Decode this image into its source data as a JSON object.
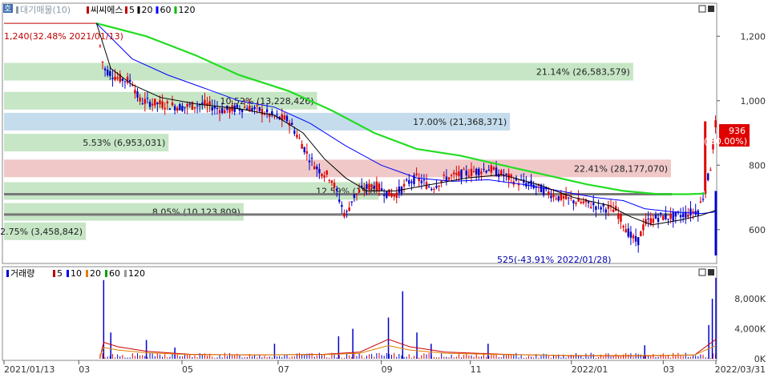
{
  "price_panel": {
    "legend": {
      "badge": "호",
      "items": [
        {
          "label": "대기매물(10)",
          "color": "#8a9aa8"
        },
        {
          "label": "씨씨에스",
          "color": "#c00000"
        },
        {
          "label": "5",
          "color": "#c00000"
        },
        {
          "label": "20",
          "color": "#000000"
        },
        {
          "label": "60",
          "color": "#0000ff"
        },
        {
          "label": "120",
          "color": "#00bb00"
        }
      ]
    },
    "high_annotation": "1,240(32.48% 2021/01/13)",
    "low_annotation": "525(-43.91% 2022/01/28)",
    "current_price": "936",
    "current_change": "( 30.00%)",
    "price_axis": [
      "1,200",
      "1,000",
      "800",
      "600"
    ],
    "horizontal_lines": [
      710,
      647
    ]
  },
  "volume_panel": {
    "legend": {
      "title": "거래량",
      "items": [
        {
          "label": "5",
          "color": "#c00000"
        },
        {
          "label": "10",
          "color": "#0000ff"
        },
        {
          "label": "20",
          "color": "#e08000"
        },
        {
          "label": "60",
          "color": "#00a000"
        },
        {
          "label": "120",
          "color": "#999999"
        }
      ]
    },
    "volume_axis": [
      "8,000K",
      "4,000K",
      "0K"
    ]
  },
  "x_axis_labels": [
    "2021/01/13",
    "03",
    "05",
    "07",
    "09",
    "11",
    "2022/01",
    "03",
    "2022/03/31"
  ],
  "colors": {
    "up": "#e00000",
    "down": "#0000cc",
    "ma5": "#cc0000",
    "ma20": "#000000",
    "ma60": "#0000ff",
    "ma120": "#22dd22",
    "green_band": "#c6e6c6",
    "blue_band": "#c4dcec",
    "red_band": "#f0c8c8",
    "label_box": "#e00000"
  },
  "chart_data": {
    "type": "candlestick",
    "x_range": [
      "2021/01/13",
      "2022/03/31"
    ],
    "price_range": [
      500,
      1300
    ],
    "volume_range": [
      0,
      11000
    ],
    "volume_profile": [
      {
        "price": 1090,
        "label": "21.14% (26,583,579)",
        "share": 21.14,
        "volume": 26583579,
        "color": "green"
      },
      {
        "price": 1000,
        "label": "10.52% (13,228,426)",
        "share": 10.52,
        "volume": 13228426,
        "color": "green"
      },
      {
        "price": 935,
        "label": "17.00% (21,368,371)",
        "share": 17.0,
        "volume": 21368371,
        "color": "blue"
      },
      {
        "price": 870,
        "label": "5.53% (6,953,031)",
        "share": 5.53,
        "volume": 6953031,
        "color": "green"
      },
      {
        "price": 790,
        "label": "22.41% (28,177,070)",
        "share": 22.41,
        "volume": 28177070,
        "color": "red"
      },
      {
        "price": 720,
        "label": "12.59% (15,8",
        "share": 12.59,
        "volume": null,
        "color": "green"
      },
      {
        "price": 655,
        "label": "8.05% (10,123,809)",
        "share": 8.05,
        "volume": 10123809,
        "color": "green"
      },
      {
        "price": 595,
        "label": "2.75% (3,458,842)",
        "share": 2.75,
        "volume": 3458842,
        "color": "green"
      }
    ],
    "candle_path": [
      [
        0,
        1240
      ],
      [
        0.13,
        1240
      ],
      [
        0.14,
        1100
      ],
      [
        0.16,
        1070
      ],
      [
        0.18,
        1060
      ],
      [
        0.19,
        1000
      ],
      [
        0.22,
        990
      ],
      [
        0.25,
        980
      ],
      [
        0.28,
        990
      ],
      [
        0.31,
        970
      ],
      [
        0.34,
        980
      ],
      [
        0.36,
        970
      ],
      [
        0.38,
        950
      ],
      [
        0.4,
        940
      ],
      [
        0.41,
        900
      ],
      [
        0.43,
        820
      ],
      [
        0.44,
        790
      ],
      [
        0.46,
        760
      ],
      [
        0.47,
        700
      ],
      [
        0.48,
        640
      ],
      [
        0.49,
        700
      ],
      [
        0.5,
        720
      ],
      [
        0.52,
        740
      ],
      [
        0.54,
        710
      ],
      [
        0.55,
        710
      ],
      [
        0.57,
        750
      ],
      [
        0.58,
        760
      ],
      [
        0.6,
        730
      ],
      [
        0.62,
        760
      ],
      [
        0.64,
        770
      ],
      [
        0.66,
        780
      ],
      [
        0.68,
        790
      ],
      [
        0.7,
        770
      ],
      [
        0.72,
        750
      ],
      [
        0.74,
        740
      ],
      [
        0.76,
        720
      ],
      [
        0.78,
        700
      ],
      [
        0.8,
        690
      ],
      [
        0.82,
        680
      ],
      [
        0.84,
        670
      ],
      [
        0.86,
        660
      ],
      [
        0.88,
        580
      ],
      [
        0.89,
        560
      ],
      [
        0.9,
        620
      ],
      [
        0.92,
        640
      ],
      [
        0.94,
        640
      ],
      [
        0.96,
        650
      ],
      [
        0.975,
        660
      ],
      [
        0.985,
        720
      ],
      [
        0.993,
        800
      ],
      [
        1.0,
        936
      ]
    ],
    "ma20_path": [
      [
        0.13,
        1240
      ],
      [
        0.15,
        1100
      ],
      [
        0.18,
        1050
      ],
      [
        0.22,
        1010
      ],
      [
        0.27,
        990
      ],
      [
        0.33,
        975
      ],
      [
        0.38,
        955
      ],
      [
        0.42,
        900
      ],
      [
        0.45,
        820
      ],
      [
        0.48,
        760
      ],
      [
        0.51,
        720
      ],
      [
        0.55,
        720
      ],
      [
        0.6,
        740
      ],
      [
        0.65,
        760
      ],
      [
        0.7,
        770
      ],
      [
        0.75,
        740
      ],
      [
        0.8,
        700
      ],
      [
        0.85,
        675
      ],
      [
        0.88,
        640
      ],
      [
        0.91,
        615
      ],
      [
        0.95,
        630
      ],
      [
        0.98,
        645
      ],
      [
        1.0,
        660
      ]
    ],
    "ma60_path": [
      [
        0.13,
        1240
      ],
      [
        0.18,
        1130
      ],
      [
        0.23,
        1080
      ],
      [
        0.28,
        1040
      ],
      [
        0.33,
        1000
      ],
      [
        0.38,
        980
      ],
      [
        0.43,
        930
      ],
      [
        0.48,
        860
      ],
      [
        0.53,
        800
      ],
      [
        0.58,
        760
      ],
      [
        0.63,
        750
      ],
      [
        0.68,
        755
      ],
      [
        0.73,
        740
      ],
      [
        0.78,
        720
      ],
      [
        0.83,
        700
      ],
      [
        0.87,
        690
      ],
      [
        0.9,
        665
      ],
      [
        0.94,
        655
      ],
      [
        0.98,
        650
      ],
      [
        1.0,
        655
      ]
    ],
    "ma120_path": [
      [
        0.13,
        1240
      ],
      [
        0.2,
        1200
      ],
      [
        0.27,
        1140
      ],
      [
        0.33,
        1080
      ],
      [
        0.4,
        1030
      ],
      [
        0.46,
        970
      ],
      [
        0.52,
        900
      ],
      [
        0.58,
        850
      ],
      [
        0.64,
        830
      ],
      [
        0.7,
        800
      ],
      [
        0.76,
        770
      ],
      [
        0.82,
        740
      ],
      [
        0.87,
        720
      ],
      [
        0.92,
        710
      ],
      [
        0.96,
        710
      ],
      [
        0.985,
        712
      ]
    ],
    "volume_spikes": [
      [
        0.14,
        10500
      ],
      [
        0.15,
        3500
      ],
      [
        0.2,
        2500
      ],
      [
        0.24,
        1500
      ],
      [
        0.38,
        2000
      ],
      [
        0.47,
        3000
      ],
      [
        0.49,
        4000
      ],
      [
        0.54,
        5500
      ],
      [
        0.56,
        9000
      ],
      [
        0.58,
        3500
      ],
      [
        0.6,
        2000
      ],
      [
        0.68,
        2000
      ],
      [
        0.9,
        1800
      ],
      [
        0.99,
        4500
      ],
      [
        0.995,
        8000
      ],
      [
        1.0,
        10800
      ]
    ]
  }
}
